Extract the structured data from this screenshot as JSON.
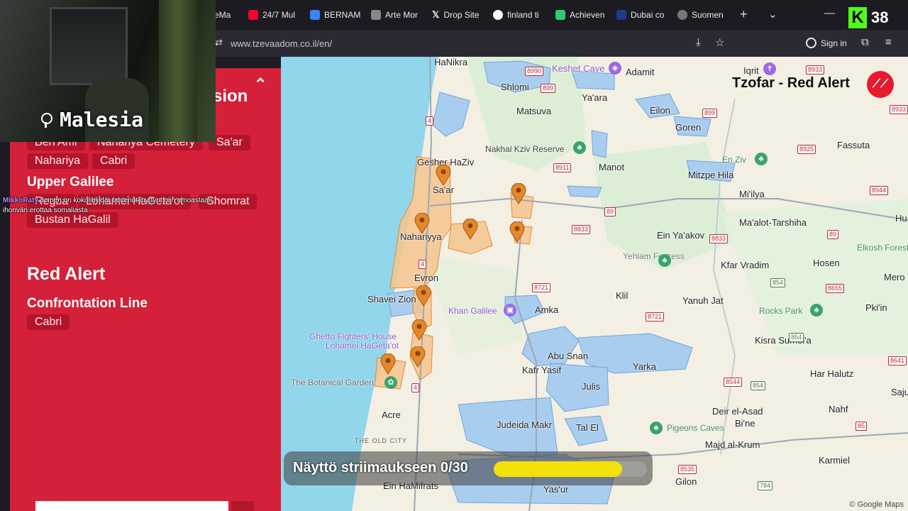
{
  "browser": {
    "tabs": [
      {
        "label": "eMa",
        "color": "#4a90e2"
      },
      {
        "label": "24/7 Mul",
        "color": "#ff0033"
      },
      {
        "label": "BERNAM",
        "color": "#3b82f6"
      },
      {
        "label": "Arte Mor",
        "color": "#888888"
      },
      {
        "label": "Drop Site",
        "color": "#111111"
      },
      {
        "label": "finland ti",
        "color": "#4285f4"
      },
      {
        "label": "Achieven",
        "color": "#2ecc71"
      },
      {
        "label": "Dubai co",
        "color": "#1e3a8a"
      },
      {
        "label": "Suomen",
        "color": "#777777"
      }
    ],
    "url": "www.tzevaadom.co.il/en/",
    "sign_in": "Sign in"
  },
  "webcam": {
    "location_label": "Malesia"
  },
  "panel": {
    "partial_title": "sion",
    "chips_top_row": [
      "Ben Ami",
      "Nahariya Cemetery",
      "Sa'ar"
    ],
    "chips_second_row": [
      "Nahariya",
      "Cabri"
    ],
    "upper_galilee_title": "Upper Galilee",
    "upper_galilee_chips": [
      "Regba",
      "Lohamei HaGeta'ot",
      "Shomrat"
    ],
    "upper_galilee_chips2": [
      "Bustan HaGalil"
    ],
    "red_alert_title": "Red Alert",
    "confrontation_title": "Confrontation Line",
    "confrontation_chips": [
      "Cabri"
    ]
  },
  "chat": {
    "user": "MikkoRaty",
    "message": "Jemen on kokolihliidär lahtenut ihyttynt niin amoastaan ihonväri erottaa somaliasta"
  },
  "map": {
    "app_title": "Tzofar - Red Alert",
    "places": {
      "hanikra": "HaNikra",
      "keshet_cave": "Keshet Cave",
      "adamit": "Adamit",
      "iqrit": "Iqrit",
      "shlomi": "Shlomi",
      "yaara": "Ya'ara",
      "eilon": "Eilon",
      "matsuva": "Matsuva",
      "goren": "Goren",
      "gesher_haziv": "Gesher HaZiv",
      "nakhal_kziv": "Nakhal Kziv Reserve",
      "manot": "Manot",
      "fassuta": "Fassuta",
      "en_ziv": "En Ziv",
      "mitzpe_hila": "Mitzpe Hila",
      "miilya": "Mi'ilya",
      "saar": "Sa'ar",
      "nahariyya": "Nahariyya",
      "ein_yaakov": "Ein Ya'akov",
      "malot_tarshiha": "Ma'alot-Tarshiha",
      "yehiam": "Yehiam Fortress",
      "kfar_vradim": "Kfar Vradim",
      "hosen": "Hosen",
      "elkosh": "Elkosh Forest",
      "evron": "Evron",
      "shavei_zion": "Shavei Zion",
      "klil": "Klil",
      "yanuh_jat": "Yanuh Jat",
      "rocks_park": "Rocks Park",
      "pkiin": "Pki'in",
      "khan_galilee": "Khan Galilee",
      "amka": "Amka",
      "ghetto_fighters": "Ghetto Fighters' House",
      "lohamei": "Lohamei HaGeta'ot",
      "kisra": "Kisra Sumei'a",
      "abu_snan": "Abu Snan",
      "kafr_yasif": "Kafr Yasif",
      "yarka": "Yarka",
      "har_halutz": "Har Halutz",
      "botanical": "The Botanical Garden",
      "julis": "Julis",
      "acre": "Acre",
      "deir_el_asad": "Deir el-Asad",
      "biine": "Bi'ne",
      "nahf": "Nahf",
      "old_city": "THE OLD CITY",
      "judeida": "Judeida Makr",
      "tal_el": "Tal El",
      "pigeons": "Pigeons Caves",
      "majd": "Majd al-Krum",
      "karmiel": "Karmiel",
      "ein_hamifrats": "Ein HaMifrats",
      "yasur": "Yas'ur",
      "gilon": "Gilon",
      "hu": "Hu",
      "mero": "Mero",
      "saju": "Saju"
    },
    "routes": [
      "8990",
      "899",
      "8933",
      "8933",
      "8925",
      "899",
      "8911",
      "8944",
      "89",
      "8833",
      "8833",
      "89",
      "854",
      "8655",
      "8721",
      "8721",
      "854",
      "8641",
      "8544",
      "854",
      "4",
      "4",
      "4",
      "8535",
      "85",
      "784"
    ],
    "copyright": "© Google Maps"
  },
  "stream": {
    "label": "Näyttö striimaukseen 0/30",
    "progress": 0.84
  },
  "kick": {
    "viewers": "38"
  }
}
